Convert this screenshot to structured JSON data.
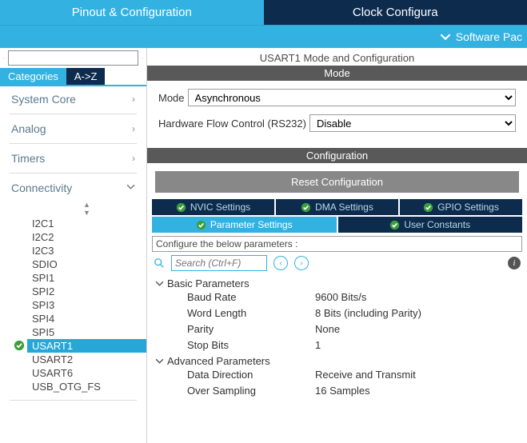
{
  "top_tabs": {
    "active": "Pinout & Configuration",
    "inactive": "Clock Configura"
  },
  "subbar": {
    "label": "Software Pac"
  },
  "left": {
    "search_placeholder": "",
    "cat_tabs": {
      "active": "Categories",
      "inactive": "A->Z"
    },
    "groups": [
      {
        "name": "System Core",
        "expanded": false
      },
      {
        "name": "Analog",
        "expanded": false
      },
      {
        "name": "Timers",
        "expanded": false
      },
      {
        "name": "Connectivity",
        "expanded": true,
        "items": [
          "I2C1",
          "I2C2",
          "I2C3",
          "SDIO",
          "SPI1",
          "SPI2",
          "SPI3",
          "SPI4",
          "SPI5",
          "USART1",
          "USART2",
          "USART6",
          "USB_OTG_FS"
        ],
        "selected": "USART1"
      }
    ]
  },
  "right": {
    "panel_title": "USART1 Mode and Configuration",
    "mode_bar": "Mode",
    "mode_label": "Mode",
    "mode_value": "Asynchronous",
    "hwfc_label": "Hardware Flow Control (RS232)",
    "hwfc_value": "Disable",
    "config_bar": "Configuration",
    "reset_btn": "Reset Configuration",
    "cfg_tabs": [
      "NVIC Settings",
      "DMA Settings",
      "GPIO Settings",
      "Parameter Settings",
      "User Constants"
    ],
    "params_header": "Configure the below parameters :",
    "search_placeholder": "Search (Ctrl+F)",
    "tree": {
      "basic": {
        "title": "Basic Parameters",
        "rows": [
          {
            "k": "Baud Rate",
            "v": "9600 Bits/s"
          },
          {
            "k": "Word Length",
            "v": "8 Bits (including Parity)"
          },
          {
            "k": "Parity",
            "v": "None"
          },
          {
            "k": "Stop Bits",
            "v": "1"
          }
        ]
      },
      "advanced": {
        "title": "Advanced Parameters",
        "rows": [
          {
            "k": "Data Direction",
            "v": "Receive and Transmit"
          },
          {
            "k": "Over Sampling",
            "v": "16 Samples"
          }
        ]
      }
    }
  }
}
